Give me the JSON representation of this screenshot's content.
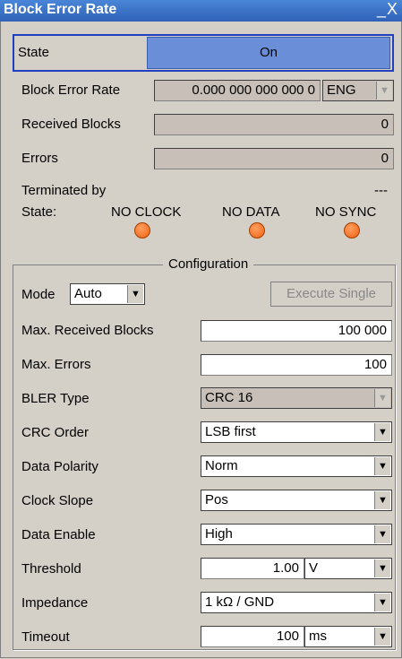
{
  "window": {
    "title": "Block Error Rate",
    "controls": "_X"
  },
  "state": {
    "label": "State",
    "value": "On"
  },
  "bler": {
    "label": "Block Error Rate",
    "value": "0.000 000 000 000 0",
    "unit": "ENG"
  },
  "received_blocks": {
    "label": "Received Blocks",
    "value": "0"
  },
  "errors": {
    "label": "Errors",
    "value": "0"
  },
  "terminated_by": {
    "label": "Terminated by",
    "value": "---"
  },
  "signal_state": {
    "label": "State:",
    "indicators": [
      "NO CLOCK",
      "NO DATA",
      "NO SYNC"
    ],
    "color": "#f06010"
  },
  "config": {
    "title": "Configuration",
    "mode_label": "Mode",
    "mode_value": "Auto",
    "execute_single": "Execute Single",
    "max_received_blocks": {
      "label": "Max. Received Blocks",
      "value": "100 000"
    },
    "max_errors": {
      "label": "Max. Errors",
      "value": "100"
    },
    "bler_type": {
      "label": "BLER Type",
      "value": "CRC 16"
    },
    "crc_order": {
      "label": "CRC Order",
      "value": "LSB first"
    },
    "data_polarity": {
      "label": "Data Polarity",
      "value": "Norm"
    },
    "clock_slope": {
      "label": "Clock Slope",
      "value": "Pos"
    },
    "data_enable": {
      "label": "Data Enable",
      "value": "High"
    },
    "threshold": {
      "label": "Threshold",
      "value": "1.00",
      "unit": "V"
    },
    "impedance": {
      "label": "Impedance",
      "value": "1 kΩ / GND"
    },
    "timeout": {
      "label": "Timeout",
      "value": "100",
      "unit": "ms"
    }
  }
}
